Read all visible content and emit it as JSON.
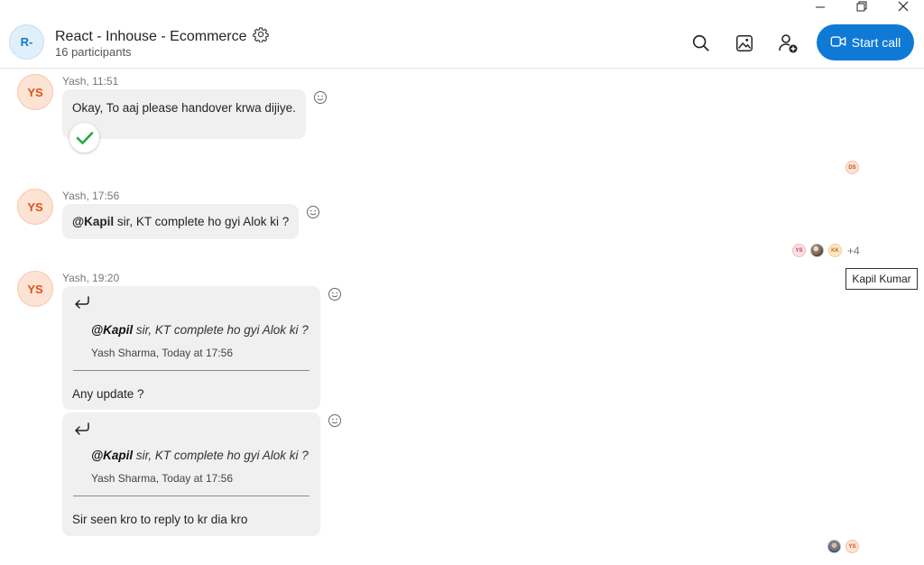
{
  "window": {
    "controls": [
      "minimize-icon",
      "restore-icon",
      "close-icon"
    ]
  },
  "header": {
    "avatar_initials": "R-",
    "title": "React - Inhouse - Ecommerce",
    "participants": "16 participants",
    "start_call_label": "Start call",
    "icons": [
      "search-icon",
      "gallery-icon",
      "add-people-icon",
      "video-icon",
      "settings-icon"
    ]
  },
  "messages": [
    {
      "avatar": "YS",
      "meta": "Yash, 11:51",
      "text": "Okay, To aaj please handover krwa dijiye.",
      "reaction": "checkmark"
    },
    {
      "avatar": "YS",
      "meta": "Yash, 17:56",
      "mention": "@Kapil",
      "text": " sir, KT complete ho gyi Alok ki ?"
    },
    {
      "avatar": "YS",
      "meta": "Yash, 19:20",
      "replies": [
        {
          "quote_mention": "@Kapil",
          "quote_text": " sir, KT complete ho gyi Alok ki ?",
          "quote_meta": "Yash Sharma, Today at 17:56",
          "text": "Any update ?"
        },
        {
          "quote_mention": "@Kapil",
          "quote_text": " sir, KT complete ho gyi Alok ki ?",
          "quote_meta": "Yash Sharma, Today at 17:56",
          "text": "Sir seen kro to reply to kr dia kro"
        }
      ]
    }
  ],
  "read_receipts": {
    "first": [
      "DS"
    ],
    "second": [
      "YS",
      "KK"
    ],
    "second_more": "+4",
    "third": [
      "YS"
    ]
  },
  "tooltip": "Kapil Kumar",
  "colors": {
    "accent": "#0f7ad6",
    "bubble": "#f0f0f0",
    "avatar_text": "#d9531e"
  }
}
